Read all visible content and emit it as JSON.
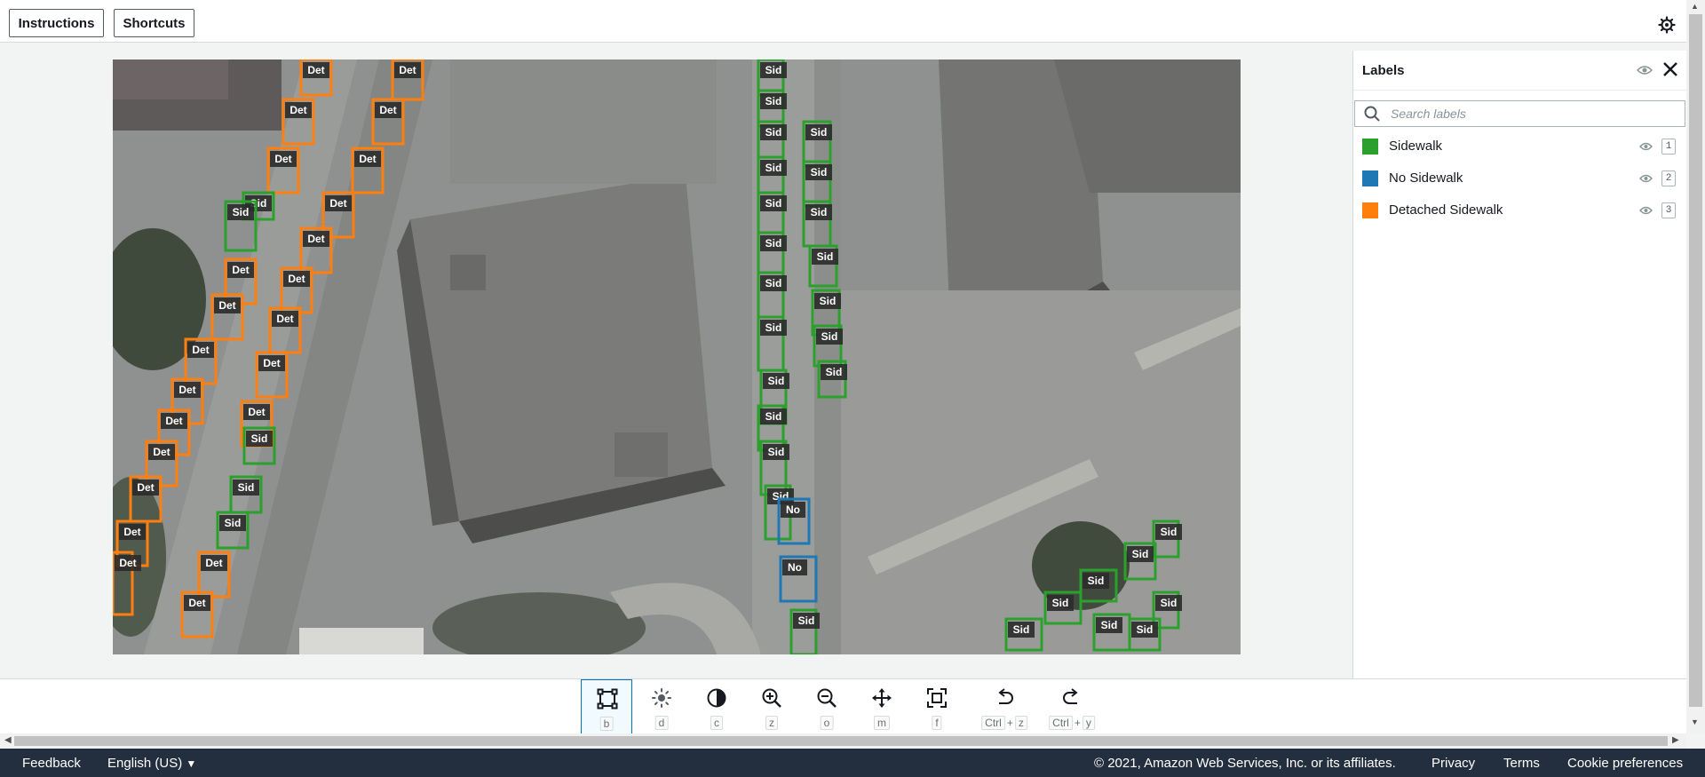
{
  "header": {
    "instructions_label": "Instructions",
    "shortcuts_label": "Shortcuts",
    "settings_icon": "gear-icon"
  },
  "labels_panel": {
    "title": "Labels",
    "search_placeholder": "Search labels",
    "items": [
      {
        "label": "Sidewalk",
        "color": "#2ca02c",
        "hotkey": "1"
      },
      {
        "label": "No Sidewalk",
        "color": "#1f77b4",
        "hotkey": "2"
      },
      {
        "label": "Detached Sidewalk",
        "color": "#ff7f0e",
        "hotkey": "3"
      }
    ]
  },
  "annotation_tags": {
    "sidewalk": "Sid",
    "no_sidewalk": "No",
    "detached": "Det"
  },
  "toolbar": {
    "tools": [
      {
        "name": "bounding-box-tool",
        "icon": "bounding-box-icon",
        "key": "b"
      },
      {
        "name": "brightness-tool",
        "icon": "brightness-icon",
        "key": "d"
      },
      {
        "name": "contrast-tool",
        "icon": "contrast-icon",
        "key": "c"
      },
      {
        "name": "zoom-in-tool",
        "icon": "zoom-in-icon",
        "key": "z"
      },
      {
        "name": "zoom-out-tool",
        "icon": "zoom-out-icon",
        "key": "o"
      },
      {
        "name": "move-tool",
        "icon": "move-icon",
        "key": "m"
      },
      {
        "name": "fit-image-tool",
        "icon": "fit-icon",
        "key": "f"
      },
      {
        "name": "undo-tool",
        "icon": "undo-icon",
        "key_mod": "Ctrl",
        "key_plus": "+",
        "key_main": "z"
      },
      {
        "name": "redo-tool",
        "icon": "redo-icon",
        "key_mod": "Ctrl",
        "key_plus": "+",
        "key_main": "y"
      }
    ]
  },
  "footer": {
    "feedback": "Feedback",
    "language": "English (US)",
    "copyright": "© 2021, Amazon Web Services, Inc. or its affiliates.",
    "privacy": "Privacy",
    "terms": "Terms",
    "cookie": "Cookie preferences"
  }
}
